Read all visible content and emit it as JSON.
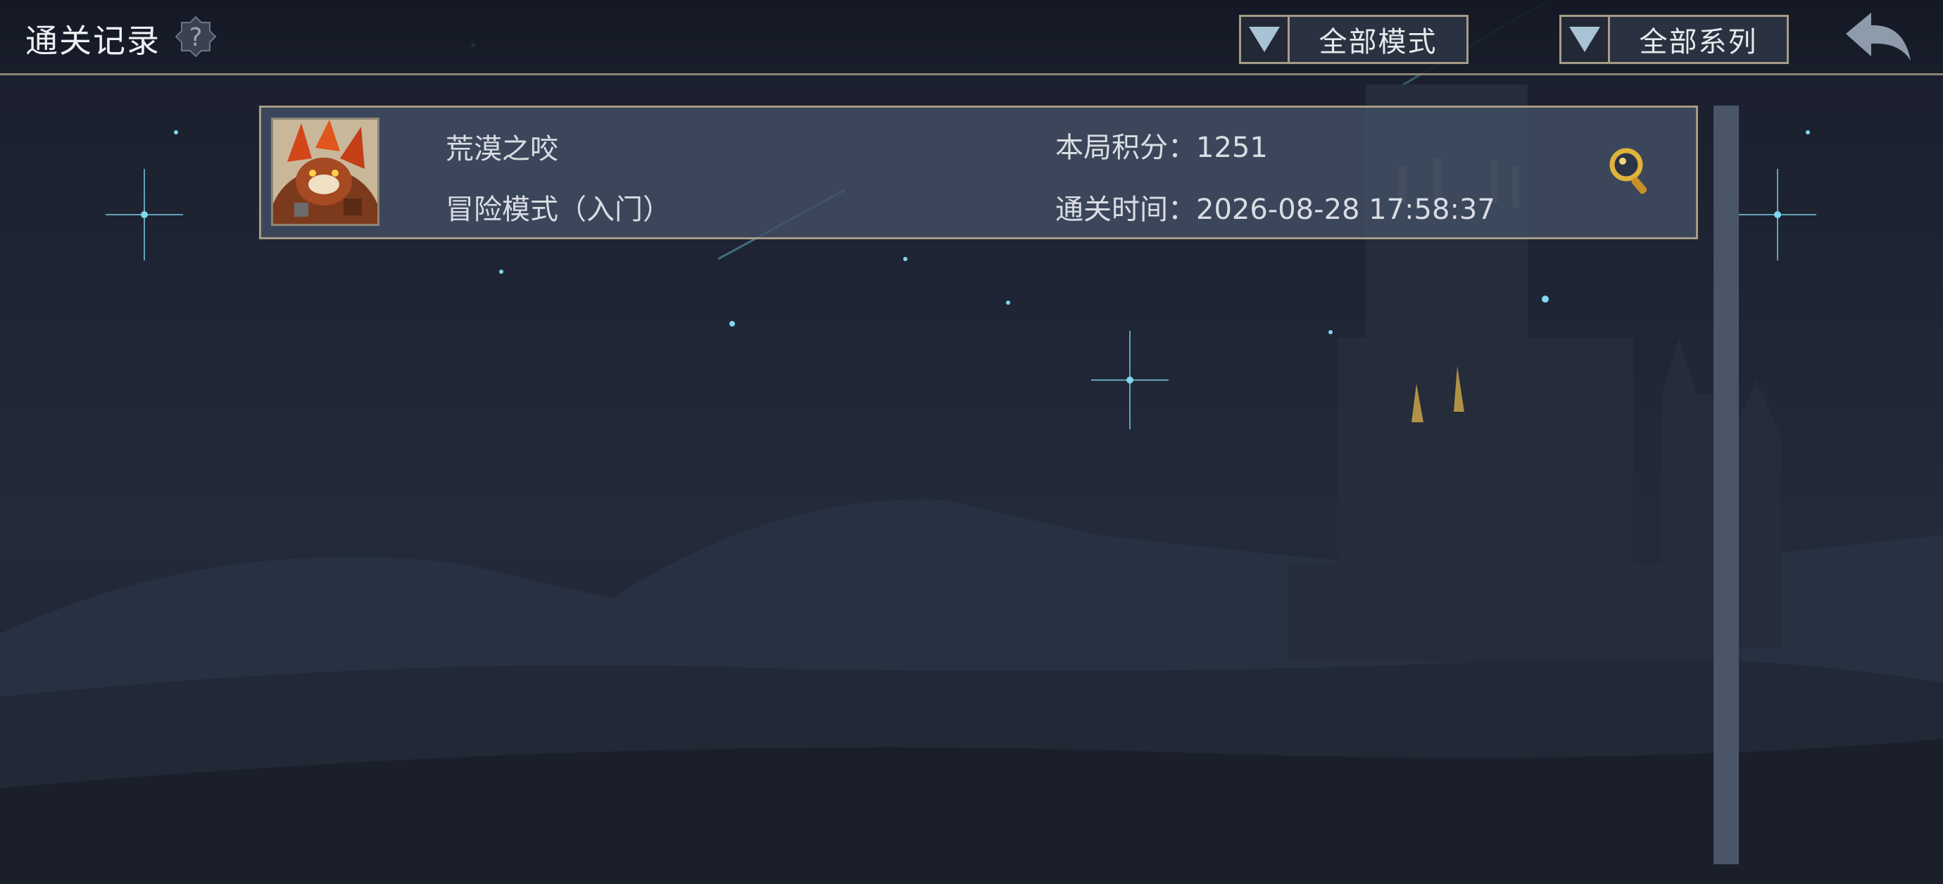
{
  "header": {
    "title": "通关记录",
    "help_icon": "question-mark-icon",
    "mode_filter": {
      "selected": "全部模式",
      "icon": "triangle-down-icon"
    },
    "series_filter": {
      "selected": "全部系列",
      "icon": "triangle-down-icon"
    },
    "back_icon": "back-arrow-icon"
  },
  "records": [
    {
      "name": "荒漠之咬",
      "mode": "冒险模式（入门）",
      "score_label": "本局积分：",
      "score": "1251",
      "time_label": "通关时间：",
      "time": "2026-08-28 17:58:37",
      "avatar_icon": "monster-portrait-icon",
      "detail_icon": "magnifier-icon"
    }
  ],
  "colors": {
    "accent_border": "#a59c86",
    "panel": "#424e64",
    "background": "#1d2230",
    "gold": "#d9a830"
  }
}
